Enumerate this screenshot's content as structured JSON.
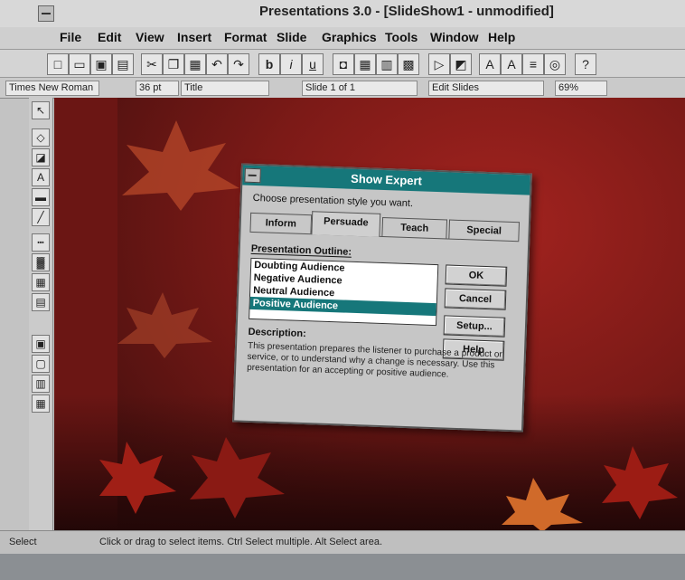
{
  "app": {
    "title": "Presentations 3.0 - [SlideShow1 - unmodified]"
  },
  "menubar": {
    "items": [
      "File",
      "Edit",
      "View",
      "Insert",
      "Format",
      "Slide",
      "Graphics",
      "Tools",
      "Window",
      "Help"
    ]
  },
  "toolbar": {
    "bold": "b",
    "italic": "i",
    "underline": "u"
  },
  "format_bar": {
    "font": "Times New Roman",
    "size": "36 pt",
    "style": "Title",
    "slide_nav": "Slide 1 of 1",
    "view": "Edit Slides",
    "zoom": "69%"
  },
  "dialog": {
    "title": "Show Expert",
    "prompt": "Choose presentation style you want.",
    "tabs": [
      "Inform",
      "Persuade",
      "Teach",
      "Special"
    ],
    "active_tab": "Persuade",
    "outline_label": "Presentation Outline:",
    "outline_items": [
      "Doubting Audience",
      "Negative Audience",
      "Neutral Audience",
      "Positive Audience"
    ],
    "selected_item": "Positive Audience",
    "buttons": {
      "ok": "OK",
      "cancel": "Cancel",
      "setup": "Setup...",
      "help": "Help"
    },
    "description_label": "Description:",
    "description_text": "This presentation prepares the listener to purchase a product or service, or to understand why a change is necessary. Use this presentation for an accepting or positive audience."
  },
  "status": {
    "mode": "Select",
    "hint": "Click or drag to select items. Ctrl Select multiple. Alt Select area."
  },
  "colors": {
    "dialog_title": "#16777a",
    "slide_background": "#7c1a17"
  }
}
